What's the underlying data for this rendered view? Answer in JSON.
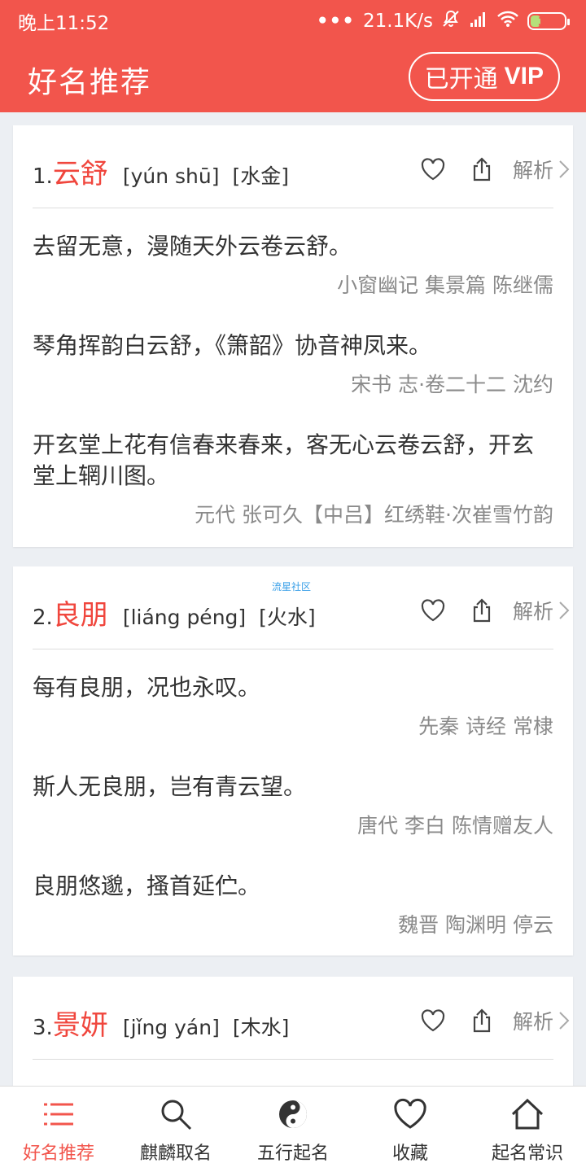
{
  "status_bar": {
    "time": "晚上11:52",
    "dots": "•••",
    "net_speed": "21.1K/s",
    "battery": "30",
    "battery_level_percent": 30
  },
  "app_bar": {
    "title": "好名推荐",
    "vip_prefix": "已开通",
    "vip_label": "VIP"
  },
  "watermark": "流星社区",
  "cards": [
    {
      "num": "1.",
      "name": "云舒",
      "pinyin": "[yún shū]",
      "wuxing": "[水金]",
      "analysis": "解析",
      "quotes": [
        {
          "line": "去留无意，漫随天外云卷云舒。",
          "source": "小窗幽记 集景篇 陈继儒"
        },
        {
          "line": "琴角挥韵白云舒，《箫韶》协音神凤来。",
          "source": "宋书 志·卷二十二 沈约"
        },
        {
          "line": "开玄堂上花有信春来春来，客无心云卷云舒，开玄堂上辋川图。",
          "source": "元代 张可久【中吕】红绣鞋·次崔雪竹韵"
        }
      ]
    },
    {
      "num": "2.",
      "name": "良朋",
      "pinyin": "[liáng péng]",
      "wuxing": "[火水]",
      "analysis": "解析",
      "quotes": [
        {
          "line": "每有良朋，况也永叹。",
          "source": "先秦 诗经 常棣"
        },
        {
          "line": "斯人无良朋，岂有青云望。",
          "source": "唐代 李白 陈情赠友人"
        },
        {
          "line": "良朋悠邈，搔首延伫。",
          "source": "魏晋 陶渊明 停云"
        }
      ]
    },
    {
      "num": "3.",
      "name": "景妍",
      "pinyin": "[jǐng yán]",
      "wuxing": "[木水]",
      "analysis": "解析",
      "quotes": []
    }
  ],
  "bottom_nav": [
    {
      "label": "好名推荐",
      "icon": "list-icon",
      "active": true
    },
    {
      "label": "麒麟取名",
      "icon": "search-icon",
      "active": false
    },
    {
      "label": "五行起名",
      "icon": "yin-yang-icon",
      "active": false
    },
    {
      "label": "收藏",
      "icon": "heart-icon",
      "active": false
    },
    {
      "label": "起名常识",
      "icon": "home-icon",
      "active": false
    }
  ],
  "colors": {
    "accent": "#f2554c",
    "name_red": "#f0463d",
    "text": "#333333",
    "muted": "#8a8a8a",
    "background": "#eceff3"
  }
}
